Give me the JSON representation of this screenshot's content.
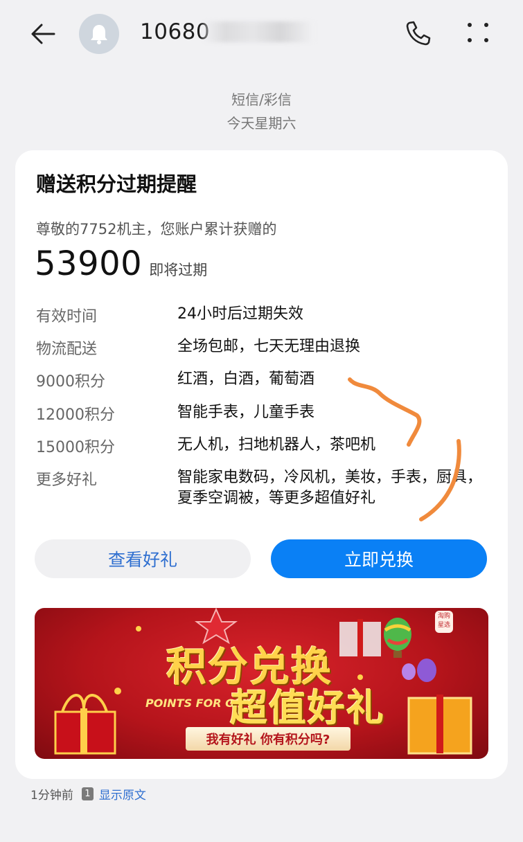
{
  "header": {
    "phone_number_visible": "10680",
    "icons": {
      "back": "back-arrow-icon",
      "avatar": "bell-icon",
      "call": "phone-icon",
      "more": "more-icon"
    }
  },
  "meta": {
    "message_type": "短信/彩信",
    "date_label": "今天星期六"
  },
  "card": {
    "title": "赠送积分过期提醒",
    "greeting": "尊敬的7752机主，您账户累计获赠的",
    "points_value": "53900",
    "points_suffix": "即将过期",
    "rows": [
      {
        "label": "有效时间",
        "value": "24小时后过期失效"
      },
      {
        "label": "物流配送",
        "value": "全场包邮，七天无理由退换"
      },
      {
        "label": "9000积分",
        "value": "红酒，白酒，葡萄酒"
      },
      {
        "label": "12000积分",
        "value": "智能手表，儿童手表"
      },
      {
        "label": "15000积分",
        "value": "无人机，扫地机器人，茶吧机"
      },
      {
        "label": "更多好礼",
        "value": "智能家电数码，冷风机，美妆，手表，厨具，夏季空调被，等更多超值好礼"
      }
    ],
    "view_button": "查看好礼",
    "redeem_button": "立即兑换"
  },
  "banner": {
    "title": "积分兑换",
    "subtitle": "超值好礼",
    "english": "POINTS FOR GIFT",
    "ribbon": "我有好礼 你有积分吗?",
    "tag": "淘购星选"
  },
  "footer": {
    "time": "1分钟前",
    "sim": "1",
    "show_original": "显示原文"
  },
  "colors": {
    "accent": "#0a80f5",
    "link": "#2f6fd0",
    "scribble": "#f08a3c",
    "banner_red": "#c4161e"
  }
}
